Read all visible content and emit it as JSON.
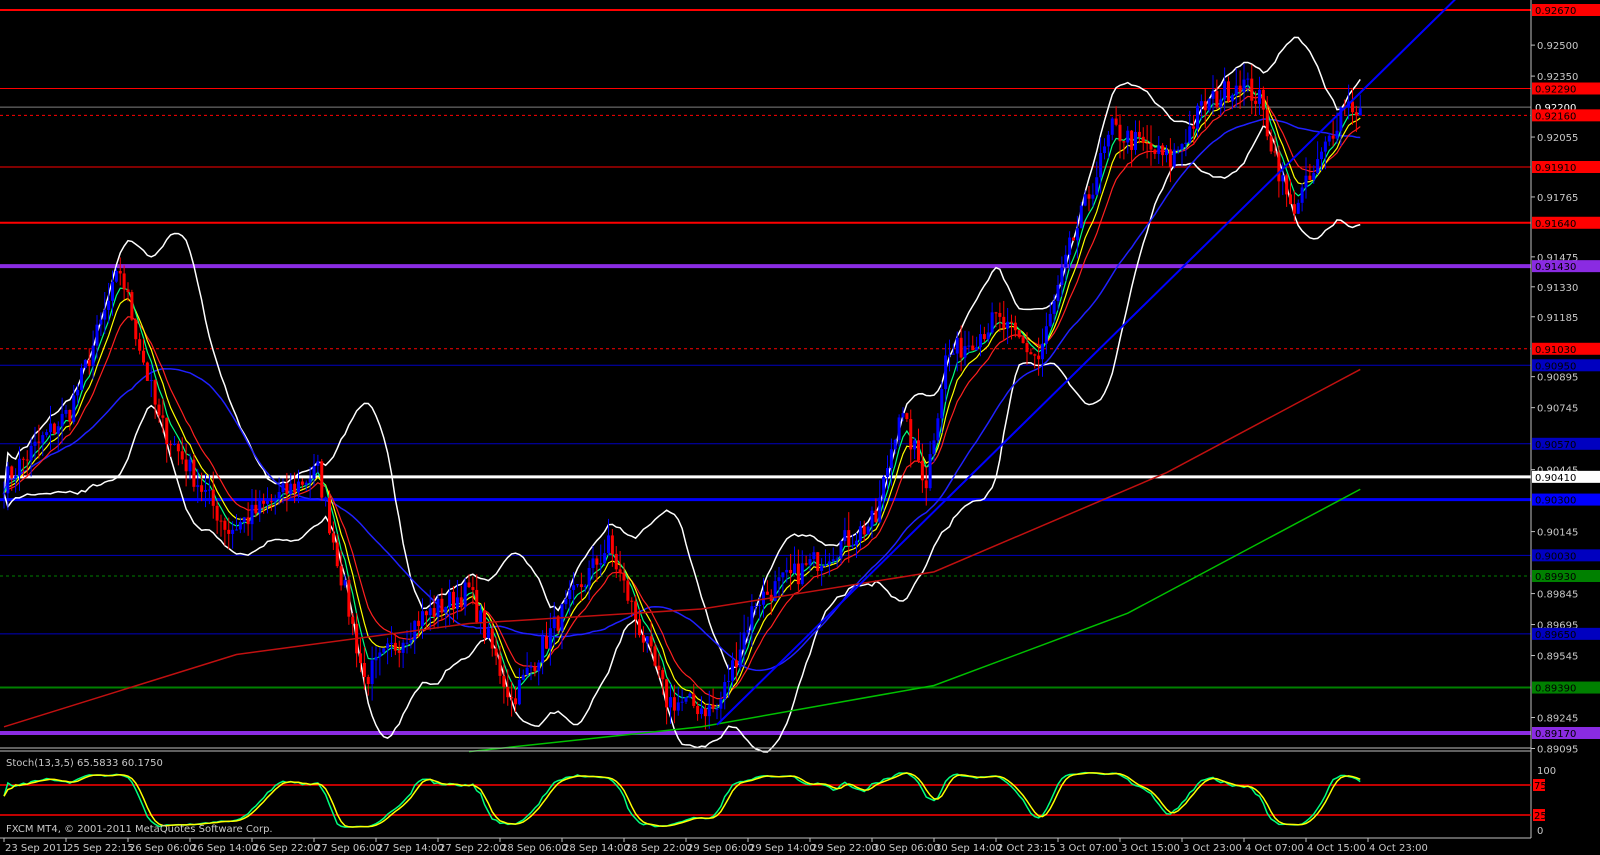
{
  "chart_data": {
    "type": "candlestick",
    "title": "",
    "footer": "FXCM MT4, © 2001-2011 MetaQuotes Software Corp.",
    "ylim": [
      0.8907,
      0.927
    ],
    "colors": {
      "bull": "#0000ff",
      "bear": "#ff0000",
      "background": "#000000",
      "axis": "#c0c0c0"
    },
    "price_ticks": [
      "0.92500",
      "0.92350",
      "0.92055",
      "0.91765",
      "0.91475",
      "0.91330",
      "0.91185",
      "0.90895",
      "0.90745",
      "0.90445",
      "0.90145",
      "0.89845",
      "0.89695",
      "0.89545",
      "0.89245",
      "0.89095"
    ],
    "time_labels": [
      "23 Sep 2011",
      "25 Sep 22:15",
      "26 Sep 06:00",
      "26 Sep 14:00",
      "26 Sep 22:00",
      "27 Sep 06:00",
      "27 Sep 14:00",
      "27 Sep 22:00",
      "28 Sep 06:00",
      "28 Sep 14:00",
      "28 Sep 22:00",
      "29 Sep 06:00",
      "29 Sep 14:00",
      "29 Sep 22:00",
      "30 Sep 06:00",
      "30 Sep 14:00",
      "2 Oct 23:15",
      "3 Oct 07:00",
      "3 Oct 15:00",
      "3 Oct 23:00",
      "4 Oct 07:00",
      "4 Oct 15:00",
      "4 Oct 23:00"
    ],
    "bars_per_label": 16,
    "price_path": [
      [
        0,
        0.9039
      ],
      [
        17,
        0.9073
      ],
      [
        30,
        0.9141
      ],
      [
        40,
        0.9068
      ],
      [
        58,
        0.9015
      ],
      [
        81,
        0.9044
      ],
      [
        93,
        0.8943
      ],
      [
        107,
        0.8972
      ],
      [
        120,
        0.8986
      ],
      [
        131,
        0.8933
      ],
      [
        143,
        0.8972
      ],
      [
        156,
        0.9008
      ],
      [
        171,
        0.8933
      ],
      [
        184,
        0.8928
      ],
      [
        194,
        0.8981
      ],
      [
        210,
        0.9001
      ],
      [
        225,
        0.902
      ],
      [
        231,
        0.9073
      ],
      [
        238,
        0.9039
      ],
      [
        243,
        0.9098
      ],
      [
        256,
        0.9117
      ],
      [
        267,
        0.9098
      ],
      [
        275,
        0.9151
      ],
      [
        286,
        0.9209
      ],
      [
        301,
        0.9194
      ],
      [
        309,
        0.9219
      ],
      [
        319,
        0.9233
      ],
      [
        324,
        0.9223
      ],
      [
        332,
        0.917
      ],
      [
        338,
        0.9187
      ],
      [
        346,
        0.9223
      ],
      [
        350,
        0.9218
      ]
    ],
    "horizontal_levels": [
      {
        "price": "0.92670",
        "color": "#ff0000",
        "style": "solid",
        "width": 2
      },
      {
        "price": "0.92290",
        "color": "#ff0000",
        "style": "solid",
        "width": 1
      },
      {
        "price": "0.92200",
        "color": "#808080",
        "style": "solid",
        "width": 1,
        "label_color": "#ffffff"
      },
      {
        "price": "0.92160",
        "color": "#ff0000",
        "style": "dotted",
        "width": 1
      },
      {
        "price": "0.91910",
        "color": "#ff0000",
        "style": "solid",
        "width": 1
      },
      {
        "price": "0.91640",
        "color": "#ff0000",
        "style": "solid",
        "width": 2
      },
      {
        "price": "0.91430",
        "color": "#8a2be2",
        "style": "solid",
        "width": 4
      },
      {
        "price": "0.91030",
        "color": "#ff0000",
        "style": "dotted",
        "width": 1
      },
      {
        "price": "0.90950",
        "color": "#0000c0",
        "style": "solid",
        "width": 1
      },
      {
        "price": "0.90570",
        "color": "#0000c0",
        "style": "solid",
        "width": 1
      },
      {
        "price": "0.90410",
        "color": "#ffffff",
        "style": "solid",
        "width": 3
      },
      {
        "price": "0.90300",
        "color": "#0000ff",
        "style": "solid",
        "width": 3
      },
      {
        "price": "0.90030",
        "color": "#0000c0",
        "style": "solid",
        "width": 1
      },
      {
        "price": "0.89930",
        "color": "#008000",
        "style": "dotted",
        "width": 1
      },
      {
        "price": "0.89650",
        "color": "#0000c0",
        "style": "solid",
        "width": 1
      },
      {
        "price": "0.89390",
        "color": "#008000",
        "style": "solid",
        "width": 2
      },
      {
        "price": "0.89170",
        "color": "#8a2be2",
        "style": "solid",
        "width": 4
      }
    ],
    "trendline": {
      "from": [
        184,
        0.8921
      ],
      "to": [
        365,
        0.9255
      ],
      "color": "#0000ff"
    },
    "long_ma_red": [
      [
        0,
        0.892
      ],
      [
        60,
        0.8955
      ],
      [
        120,
        0.897
      ],
      [
        180,
        0.8977
      ],
      [
        240,
        0.8995
      ],
      [
        300,
        0.9043
      ],
      [
        350,
        0.9093
      ]
    ],
    "long_ma_green": [
      [
        120,
        0.8908
      ],
      [
        180,
        0.892
      ],
      [
        240,
        0.894
      ],
      [
        290,
        0.8975
      ],
      [
        350,
        0.9035
      ]
    ],
    "stochastic": {
      "label": "Stoch(13,3,5) 65.5833 60.1750",
      "k": 13,
      "d": 3,
      "slowing": 5,
      "levels": [
        "75",
        "25"
      ],
      "scale": [
        "100",
        "0"
      ],
      "main_color": "#00ff7f",
      "signal_color": "#ffff00"
    }
  }
}
